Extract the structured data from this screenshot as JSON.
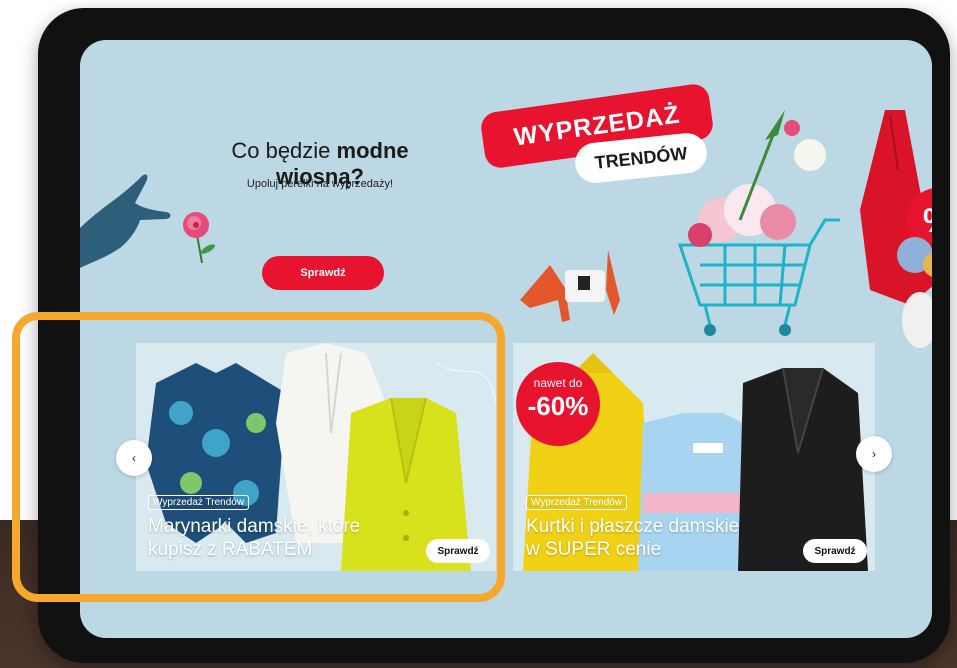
{
  "hero": {
    "title_prefix": "Co będzie ",
    "title_bold": "modne wiosną?",
    "subtitle": "Upoluj perełki na wyprzedaży!",
    "cta_label": "Sprawdź",
    "badge_line1": "WYPRZEDAŻ",
    "badge_line2": "TRENDÓW",
    "percent_symbol": "%"
  },
  "carousel": {
    "prev_symbol": "‹",
    "next_symbol": "›",
    "cards": [
      {
        "tag": "Wyprzedaż Trendów",
        "title_line1": "Marynarki damskie, które",
        "title_line2": "kupisz z RABATEM",
        "button": "Sprawdź"
      },
      {
        "tag": "Wyprzedaż Trendów",
        "title_line1": "Kurtki i płaszcze damskie",
        "title_line2": "w SUPER cenie",
        "button": "Sprawdź",
        "badge_small": "nawet do",
        "badge_big": "-60%"
      }
    ]
  },
  "colors": {
    "brand_red": "#e8132f",
    "screen_bg": "#bcd8e4",
    "highlight_orange": "#f5a82c"
  }
}
